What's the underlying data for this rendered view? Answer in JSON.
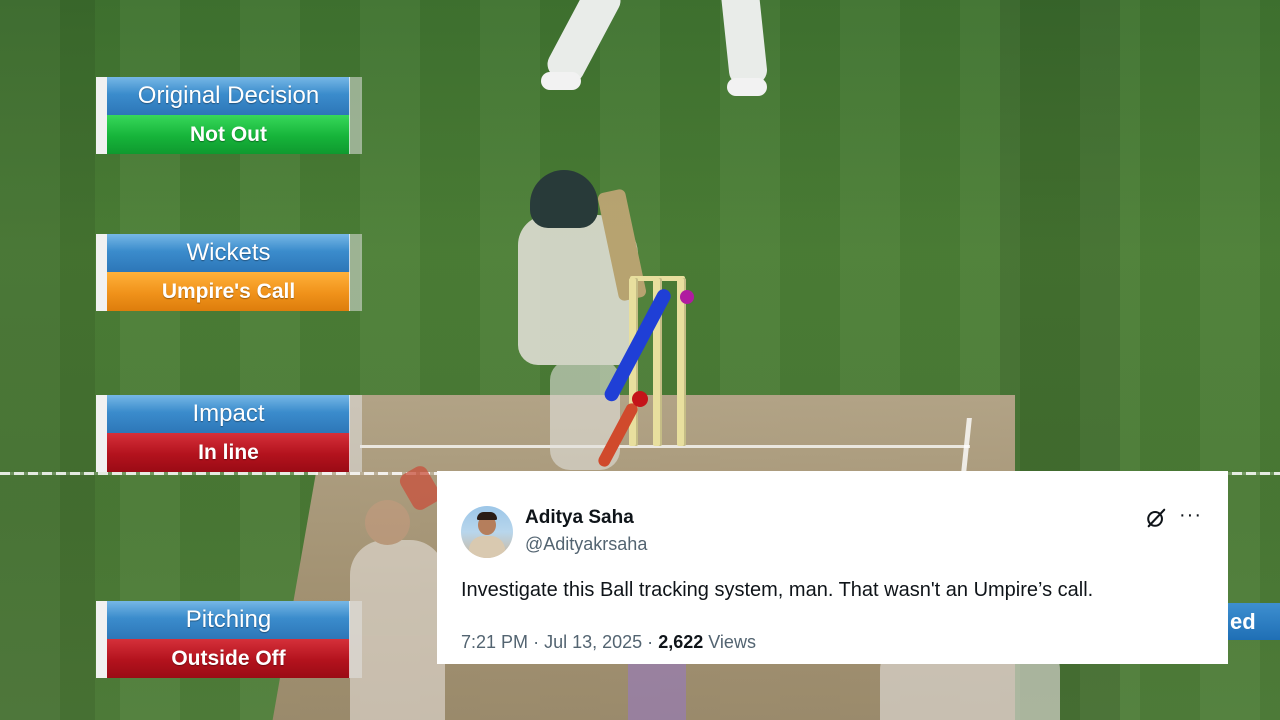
{
  "drs_panels": [
    {
      "header": "Original Decision",
      "value": "Not Out",
      "value_color": "#16b43a"
    },
    {
      "header": "Wickets",
      "value": "Umpire's Call",
      "value_color": "#f0921a"
    },
    {
      "header": "Impact",
      "value": "In line",
      "value_color": "#b3121d"
    },
    {
      "header": "Pitching",
      "value": "Outside Off",
      "value_color": "#b3121d"
    }
  ],
  "partial_label": "ed",
  "tweet": {
    "author_name": "Aditya Saha",
    "author_handle": "@Adityakrsaha",
    "text": "Investigate this Ball tracking system, man. That wasn't an Umpire’s call.",
    "time": "7:21 PM",
    "date": "Jul 13, 2025",
    "separator": "·",
    "view_count": "2,622",
    "views_label": "Views",
    "grok_icon": "grok-icon",
    "more_icon": "···"
  },
  "colors": {
    "drs_header_blue": "#2d77b8",
    "ball_tracking_blue": "#1f3fd6",
    "ball_red": "#c41419"
  }
}
